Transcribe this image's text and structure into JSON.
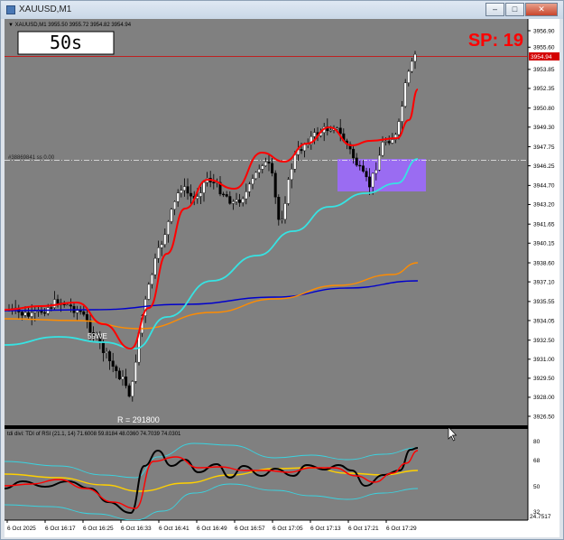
{
  "window": {
    "title": "XAUUSD,M1",
    "buttons": [
      "–",
      "□",
      "✕"
    ]
  },
  "chart": {
    "header": "▼ XAUUSD,M1  3955.50 3955.72 3954.82 3954.94",
    "timer": "50s",
    "spread": "SP: 19",
    "current_price": "3954.94",
    "hline_label": "#38869841 ss 0.00",
    "range_label": "R = 291800",
    "ma_label": "59WE",
    "price_ticks": [
      "3956.90",
      "3955.60",
      "3953.85",
      "3952.35",
      "3950.80",
      "3949.30",
      "3947.75",
      "3946.25",
      "3944.70",
      "3943.20",
      "3941.65",
      "3940.15",
      "3938.60",
      "3937.10",
      "3935.55",
      "3934.05",
      "3932.50",
      "3931.00",
      "3929.50",
      "3928.00",
      "3926.50"
    ],
    "time_ticks": [
      "6 Oct 2025",
      "6 Oct 16:17",
      "6 Oct 16:25",
      "6 Oct 16:33",
      "6 Oct 16:41",
      "6 Oct 16:49",
      "6 Oct 16:57",
      "6 Oct 17:05",
      "6 Oct 17:13",
      "6 Oct 17:21",
      "6 Oct 17:29"
    ],
    "colors": {
      "background": "#808080",
      "candle_up": "#ffffff",
      "candle_down": "#000000",
      "ma_red": "#ff0000",
      "ma_cyan": "#36e3e3",
      "ma_orange": "#ff8c00",
      "ma_blue": "#0000cc",
      "zone": "#9a6cf2",
      "spread": "#ff0000"
    }
  },
  "indicator": {
    "header": "tdi divi: TDI of RSI  (21.1, 14) 71.6008 59.8184 48.0360 74.7039 74.0301",
    "levels": [
      "80",
      "68",
      "50",
      "32"
    ],
    "bottom_value": "24.7517"
  }
}
